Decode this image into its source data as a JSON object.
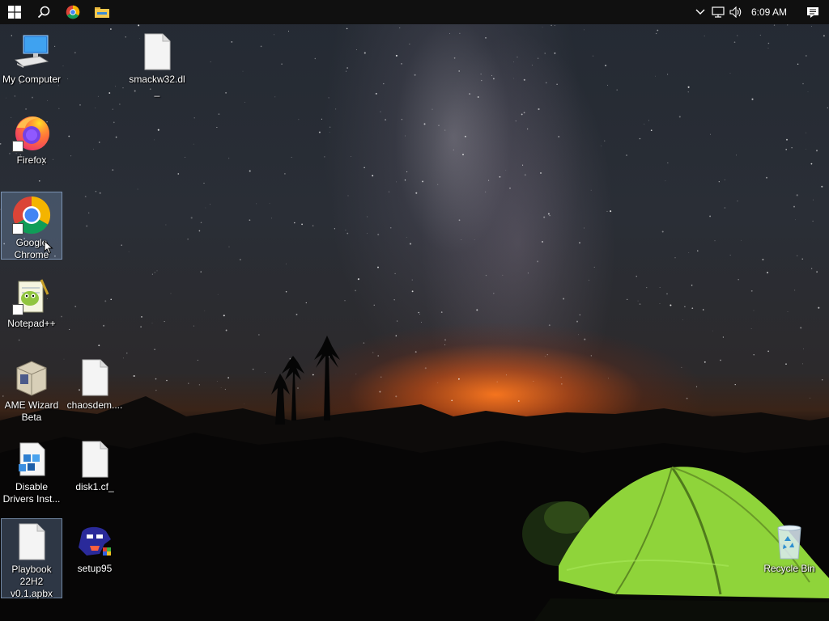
{
  "taskbar": {
    "start": "start-icon",
    "search": "search-icon",
    "pinned": [
      "chrome-icon",
      "file-explorer-icon"
    ],
    "tray": [
      "chevron-up-icon",
      "network-icon",
      "volume-icon"
    ],
    "clock": "6:09 AM",
    "notifications": "action-center-icon"
  },
  "desktop": {
    "icons": [
      {
        "label": "My Computer",
        "icon": "computer-icon"
      },
      {
        "label": "smackw32.dl_",
        "icon": "blank-file-icon"
      },
      {
        "label": "Firefox",
        "icon": "firefox-icon"
      },
      {
        "label": "Google Chrome",
        "icon": "chrome-icon",
        "selected": true
      },
      {
        "label": "Notepad++",
        "icon": "notepadpp-icon"
      },
      {
        "label": "AME Wizard Beta",
        "icon": "ame-wizard-icon"
      },
      {
        "label": "chaosdem....",
        "icon": "blank-file-icon"
      },
      {
        "label": "Disable Drivers Inst...",
        "icon": "cubes-icon"
      },
      {
        "label": "disk1.cf_",
        "icon": "blank-file-icon"
      },
      {
        "label": "Playbook 22H2 v0.1.apbx",
        "icon": "blank-file-icon",
        "selected": true
      },
      {
        "label": "setup95",
        "icon": "setup95-icon"
      },
      {
        "label": "Recycle Bin",
        "icon": "recycle-bin-icon"
      }
    ]
  },
  "colors": {
    "taskbar": "#101010",
    "tent": "#8fd43a",
    "horizon_glow": "#ff7a1e"
  }
}
